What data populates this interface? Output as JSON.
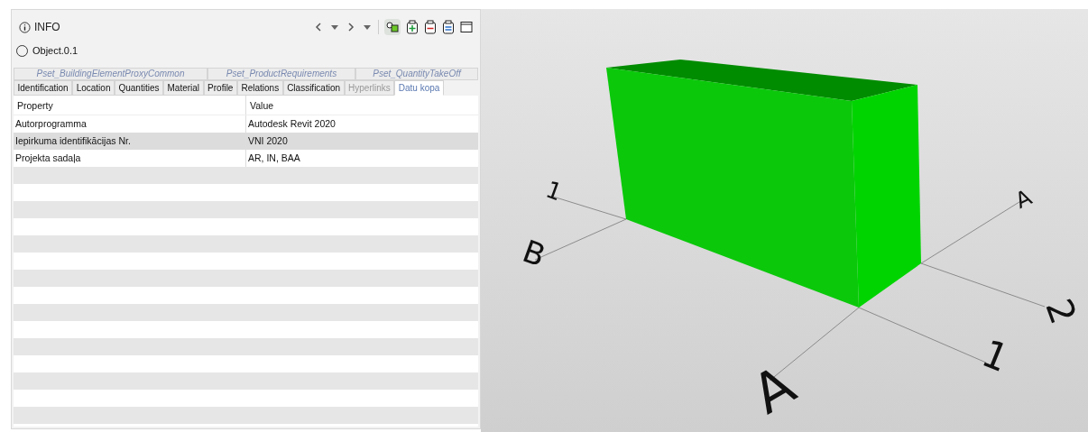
{
  "panel": {
    "title": "INFO",
    "object": {
      "label": "Object.0.1",
      "selected": false
    },
    "pset_tabs": [
      {
        "label": "Pset_BuildingElementProxyCommon"
      },
      {
        "label": "Pset_ProductRequirements"
      },
      {
        "label": "Pset_QuantityTakeOff"
      }
    ],
    "tabs": [
      {
        "label": "Identification",
        "selected": false,
        "disabled": false
      },
      {
        "label": "Location",
        "selected": false,
        "disabled": false
      },
      {
        "label": "Quantities",
        "selected": false,
        "disabled": false
      },
      {
        "label": "Material",
        "selected": false,
        "disabled": false
      },
      {
        "label": "Profile",
        "selected": false,
        "disabled": false
      },
      {
        "label": "Relations",
        "selected": false,
        "disabled": false
      },
      {
        "label": "Classification",
        "selected": false,
        "disabled": false
      },
      {
        "label": "Hyperlinks",
        "selected": false,
        "disabled": true
      },
      {
        "label": "Datu kopa",
        "selected": true,
        "disabled": false
      }
    ],
    "table": {
      "columns": [
        "Property",
        "Value"
      ],
      "rows": [
        {
          "cells": [
            "Autorprogramma",
            "Autodesk Revit 2020"
          ],
          "selected": false
        },
        {
          "cells": [
            "Iepirkuma identifikācijas Nr.",
            "VNI 2020"
          ],
          "selected": true
        },
        {
          "cells": [
            "Projekta sadaļa",
            "AR, IN, BAA"
          ],
          "selected": false
        }
      ]
    }
  },
  "viewport": {
    "grid_labels": [
      "1",
      "B",
      "A",
      "2",
      "A",
      "1"
    ]
  }
}
